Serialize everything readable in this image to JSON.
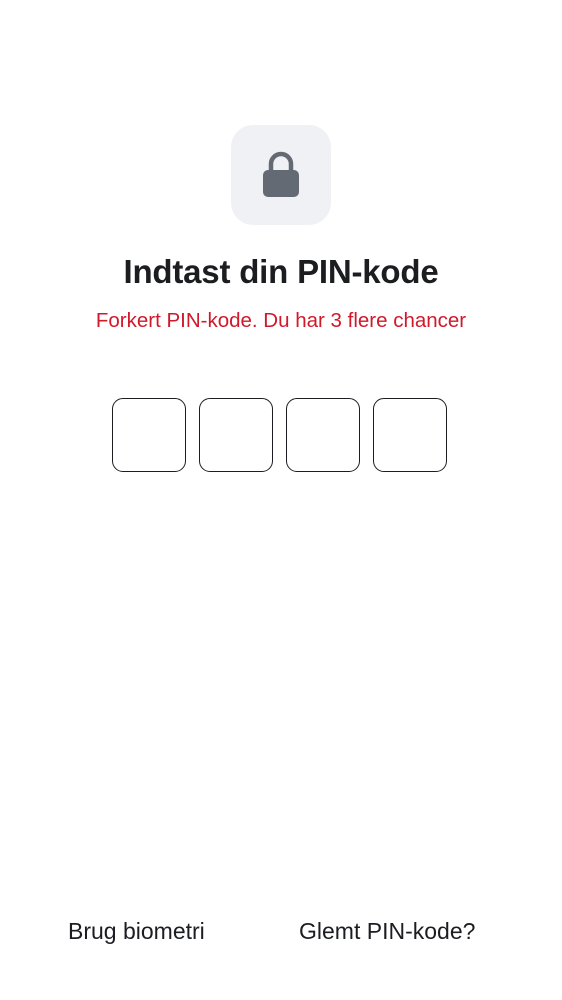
{
  "header": {
    "icon": "lock-icon",
    "title": "Indtast din PIN-kode",
    "error_message": "Forkert PIN-kode. Du har 3 flere chancer"
  },
  "pin": {
    "digit_count": 4,
    "entered_digits": 0
  },
  "footer": {
    "biometric_label": "Brug biometri",
    "forgot_label": "Glemt PIN-kode?"
  },
  "colors": {
    "error": "#d0192b",
    "text": "#1c1d21",
    "icon_bg": "#f0f1f4",
    "icon": "#646a73"
  }
}
